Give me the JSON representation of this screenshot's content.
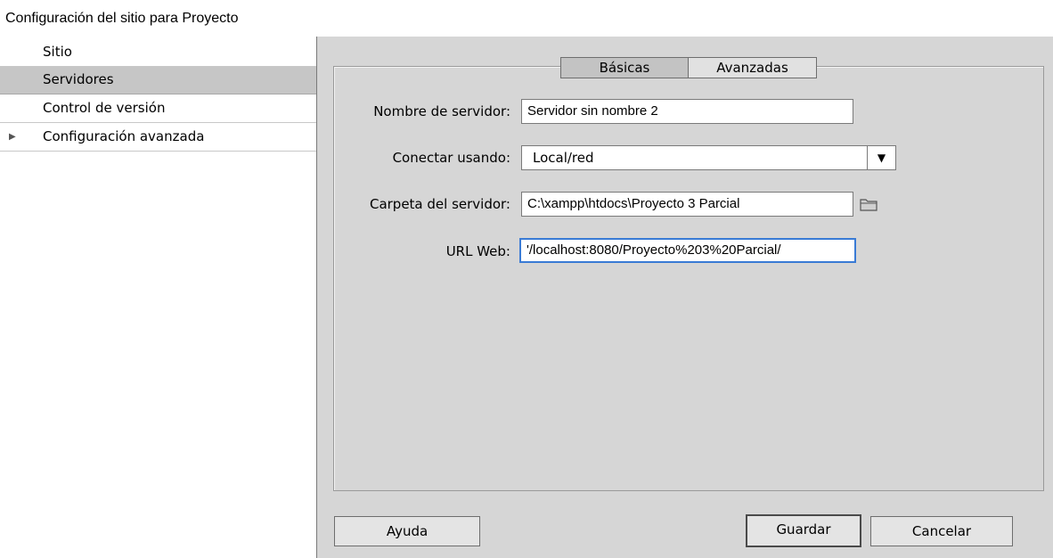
{
  "window": {
    "title": "Configuración del sitio para Proyecto"
  },
  "sidebar": {
    "items": [
      {
        "label": "Sitio"
      },
      {
        "label": "Servidores"
      },
      {
        "label": "Control de versión"
      },
      {
        "label": "Configuración avanzada"
      }
    ]
  },
  "tabs": {
    "basic": "Básicas",
    "advanced": "Avanzadas"
  },
  "form": {
    "server_name_label": "Nombre de servidor:",
    "server_name_value": "Servidor sin nombre 2",
    "connect_label": "Conectar usando:",
    "connect_value": "Local/red",
    "folder_label": "Carpeta del servidor:",
    "folder_value": "C:\\xampp\\htdocs\\Proyecto 3 Parcial",
    "url_label": "URL Web:",
    "url_value": "'/localhost:8080/Proyecto%203%20Parcial/"
  },
  "buttons": {
    "help": "Ayuda",
    "save": "Guardar",
    "cancel": "Cancelar"
  },
  "colors": {
    "panel_bg": "#d6d6d6",
    "selected_item": "#c6c6c6",
    "focus_border": "#3a7bd5"
  }
}
